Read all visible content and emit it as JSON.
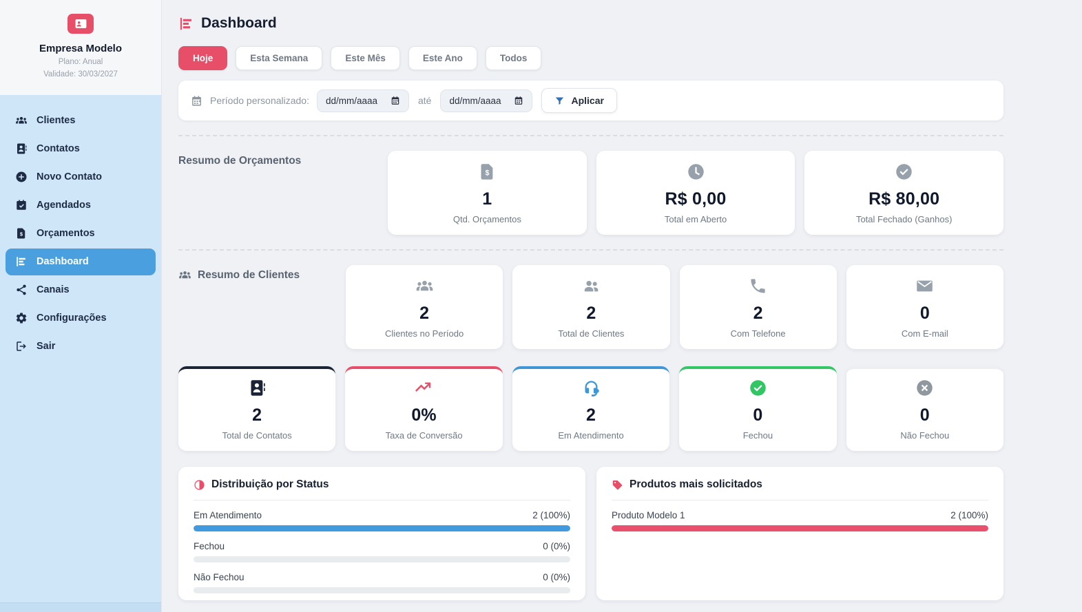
{
  "company": {
    "name": "Empresa Modelo",
    "plan": "Plano: Anual",
    "validity": "Validade: 30/03/2027",
    "badge_icon": "id-badge"
  },
  "sidebar": {
    "items": [
      {
        "label": "Clientes",
        "icon": "users",
        "slug": "clientes",
        "active": false
      },
      {
        "label": "Contatos",
        "icon": "address-book",
        "slug": "contatos",
        "active": false
      },
      {
        "label": "Novo Contato",
        "icon": "plus-circle",
        "slug": "novo-contato",
        "active": false
      },
      {
        "label": "Agendados",
        "icon": "calendar-check",
        "slug": "agendados",
        "active": false
      },
      {
        "label": "Orçamentos",
        "icon": "file-invoice",
        "slug": "orcamentos",
        "active": false
      },
      {
        "label": "Dashboard",
        "icon": "chart-bars",
        "slug": "dashboard",
        "active": true
      },
      {
        "label": "Canais",
        "icon": "share-nodes",
        "slug": "canais",
        "active": false
      },
      {
        "label": "Configurações",
        "icon": "gear",
        "slug": "configuracoes",
        "active": false
      },
      {
        "label": "Sair",
        "icon": "sign-out",
        "slug": "sair",
        "active": false
      }
    ]
  },
  "header": {
    "title": "Dashboard",
    "icon": "chart-bars"
  },
  "filters": [
    {
      "label": "Hoje",
      "active": true
    },
    {
      "label": "Esta Semana",
      "active": false
    },
    {
      "label": "Este Mês",
      "active": false
    },
    {
      "label": "Este Ano",
      "active": false
    },
    {
      "label": "Todos",
      "active": false
    }
  ],
  "period": {
    "icon": "calendar",
    "label": "Período personalizado:",
    "from_placeholder": "dd/mm/aaaa",
    "to_placeholder": "dd/mm/aaaa",
    "until_label": "até",
    "apply_label": "Aplicar",
    "apply_icon": "funnel"
  },
  "sections": {
    "orcamentos": {
      "title": "Resumo de Orçamentos",
      "cards": [
        {
          "icon": "file-invoice",
          "icon_color": "#97a1ab",
          "value": "1",
          "label": "Qtd. Orçamentos"
        },
        {
          "icon": "clock",
          "icon_color": "#97a1ab",
          "value": "R$ 0,00",
          "label": "Total em Aberto"
        },
        {
          "icon": "check-circle",
          "icon_color": "#97a1ab",
          "value": "R$ 80,00",
          "label": "Total Fechado (Ganhos)"
        }
      ]
    },
    "clientes": {
      "title": "Resumo de Clientes",
      "icon": "users",
      "cards": [
        {
          "icon": "users",
          "icon_color": "#97a1ab",
          "value": "2",
          "label": "Clientes no Período"
        },
        {
          "icon": "user-friends",
          "icon_color": "#97a1ab",
          "value": "2",
          "label": "Total de Clientes"
        },
        {
          "icon": "phone",
          "icon_color": "#97a1ab",
          "value": "2",
          "label": "Com Telefone"
        },
        {
          "icon": "envelope",
          "icon_color": "#97a1ab",
          "value": "0",
          "label": "Com E-mail"
        }
      ]
    },
    "status_cards": [
      {
        "icon": "address-book",
        "icon_color": "#1b2437",
        "accent": "#1b2437",
        "value": "2",
        "label": "Total de Contatos"
      },
      {
        "icon": "trend-up",
        "icon_color": "#e74f68",
        "accent": "#e74f68",
        "value": "0%",
        "label": "Taxa de Conversão"
      },
      {
        "icon": "headset",
        "icon_color": "#3e95d8",
        "accent": "#3f96d6",
        "value": "2",
        "label": "Em Atendimento"
      },
      {
        "icon": "check-circle",
        "icon_color": "#32c563",
        "accent": "#33c665",
        "value": "0",
        "label": "Fechou"
      },
      {
        "icon": "x-circle",
        "icon_color": "#8f979f",
        "accent": "#eceef1",
        "value": "0",
        "label": "Não Fechou"
      }
    ]
  },
  "panels": {
    "status": {
      "title": "Distribuição por Status",
      "icon": "chart-pie",
      "rows": [
        {
          "label": "Em Atendimento",
          "value": "2 (100%)",
          "pct": 100,
          "color": "#419add"
        },
        {
          "label": "Fechou",
          "value": "0 (0%)",
          "pct": 0,
          "color": "#419add"
        },
        {
          "label": "Não Fechou",
          "value": "0 (0%)",
          "pct": 0,
          "color": "#419add"
        }
      ]
    },
    "products": {
      "title": "Produtos mais solicitados",
      "icon": "tag",
      "rows": [
        {
          "label": "Produto Modelo 1",
          "value": "2 (100%)",
          "pct": 100,
          "color": "#e8506b"
        }
      ]
    }
  },
  "colors": {
    "accent_red": "#e74f68",
    "sidebar_blue": "#cfe6f8",
    "active_item_blue": "#4aa0de",
    "bar_blue": "#419add",
    "bar_red": "#e8506b",
    "green": "#33c665",
    "dark_navy": "#1b2437",
    "track_gray": "#e9ecef"
  }
}
